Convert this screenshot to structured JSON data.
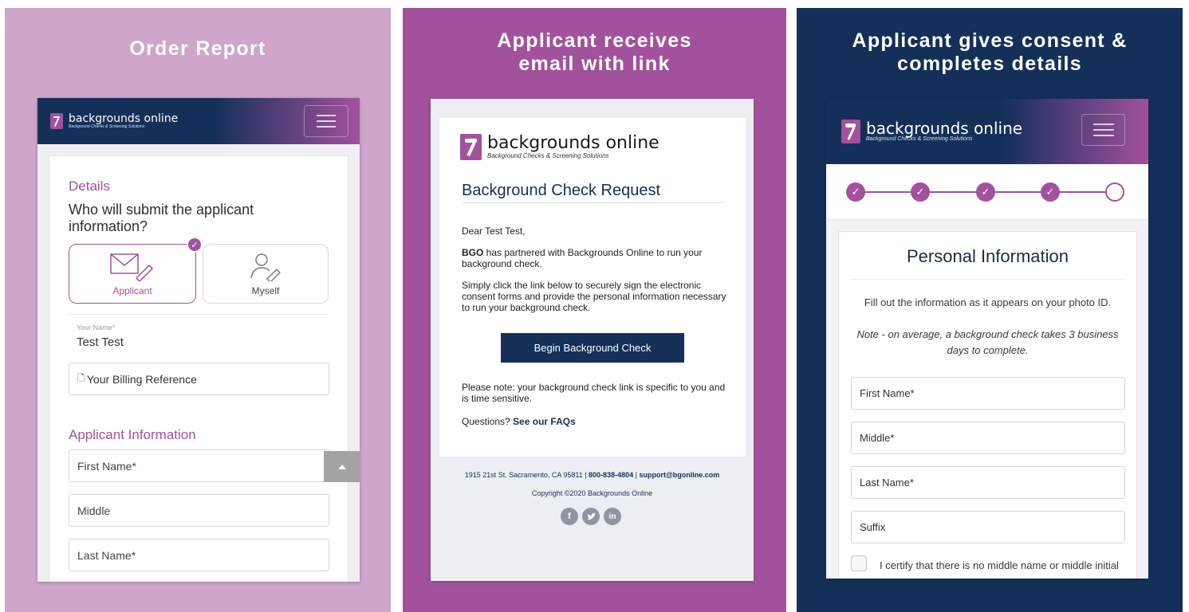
{
  "panel1": {
    "title": "Order Report",
    "logo": {
      "name": "backgrounds online",
      "tagline": "Background Checks & Screening Solutions"
    },
    "details_heading": "Details",
    "question": "Who will submit the applicant information?",
    "options": [
      {
        "label": "Applicant",
        "selected": true
      },
      {
        "label": "Myself",
        "selected": false
      }
    ],
    "your_name_label": "Your Name*",
    "your_name_value": "Test Test",
    "billing_placeholder": "Your Billing Reference",
    "applicant_heading": "Applicant Information",
    "fields": [
      "First Name*",
      "Middle",
      "Last Name*"
    ]
  },
  "panel2": {
    "title": "Applicant receives email with link",
    "logo": {
      "name": "backgrounds online",
      "tagline": "Background Checks & Screening Solutions"
    },
    "email_heading": "Background Check Request",
    "greeting": "Dear Test Test,",
    "company": "BGO",
    "p1_rest": " has partnered with Backgrounds Online to run your background check.",
    "p2": "Simply click the link below to securely sign the electronic consent forms and provide the personal information necessary to run your background check.",
    "button_label": "Begin Background Check",
    "note": "Please note: your background check link is specific to you and is time sensitive.",
    "questions_prefix": "Questions? ",
    "faq_link": "See our FAQs",
    "footer_address": "1915 21st St. Sacramento, CA 95811 | ",
    "footer_phone": "800-838-4804",
    "footer_sep": " | ",
    "footer_email": "support@bgonline.com",
    "copyright": "Copyright ©2020 Backgrounds Online",
    "social_icons": [
      "facebook-icon",
      "twitter-icon",
      "linkedin-icon"
    ]
  },
  "panel3": {
    "title": "Applicant gives consent & completes details",
    "logo": {
      "name": "backgrounds online",
      "tagline": "Background Checks & Screening Solutions"
    },
    "steps_completed": 4,
    "steps_total": 5,
    "form_heading": "Personal Information",
    "instruction": "Fill out the information as it appears on your photo ID.",
    "note": "Note - on average, a background check takes 3 business days to complete.",
    "fields": [
      "First Name*",
      "Middle*",
      "Last Name*",
      "Suffix"
    ],
    "certify_text": "I certify that there is no middle name or middle initial"
  },
  "colors": {
    "purple": "#a2519d",
    "light_purple": "#cfa5cc",
    "navy": "#143059",
    "gray_button": "#a3a3a3"
  }
}
